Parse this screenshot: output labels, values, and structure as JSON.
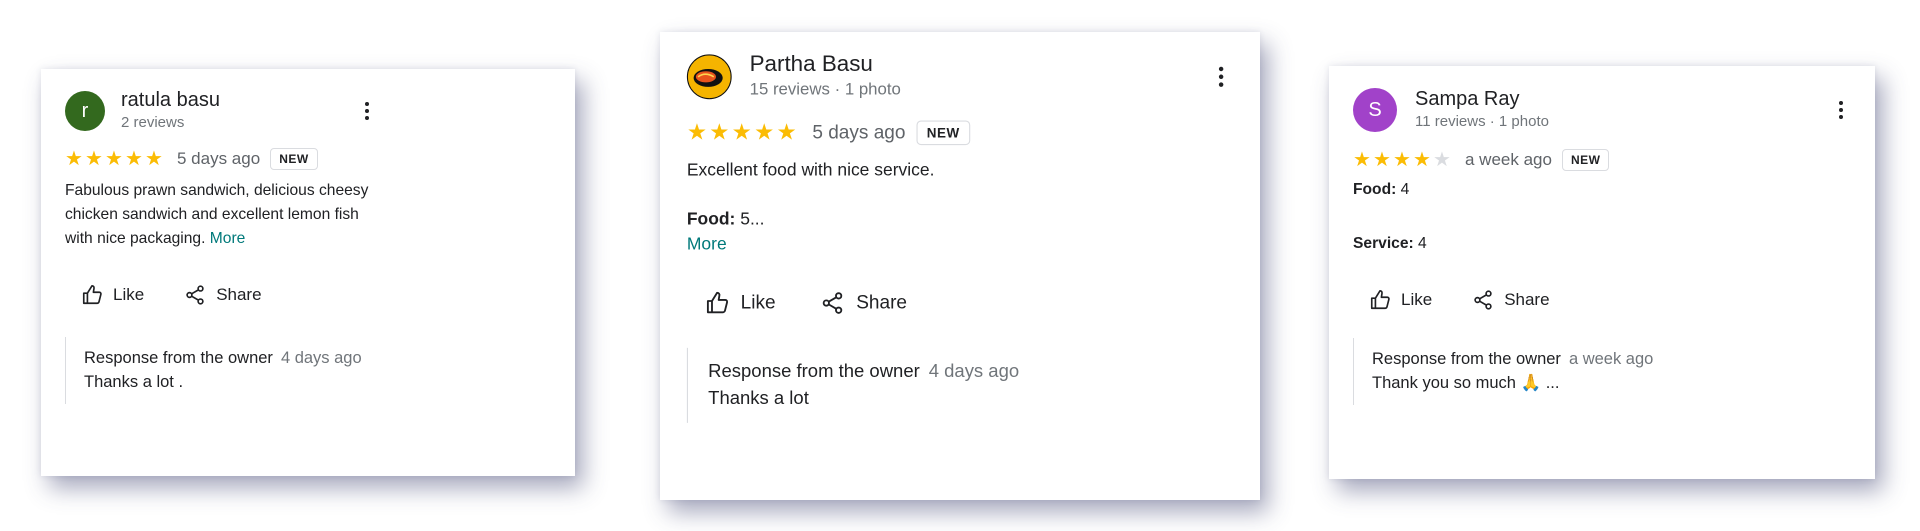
{
  "reviews": [
    {
      "reviewer_name": "ratula basu",
      "reviewer_meta": "2 reviews",
      "avatar_letter": "r",
      "avatar_color": "#33691e",
      "rating": 5,
      "time_ago": "5 days ago",
      "badge": "NEW",
      "text": "Fabulous prawn sandwich, delicious cheesy chicken sandwich and excellent lemon fish with nice packaging.",
      "more_label": "More",
      "like_label": "Like",
      "share_label": "Share",
      "owner_response_label": "Response from the owner",
      "owner_response_date": "4 days ago",
      "owner_response_text": "Thanks a lot ."
    },
    {
      "reviewer_name": "Partha Basu",
      "reviewer_meta": "15 reviews · 1 photo",
      "avatar_letter": "",
      "avatar_color": "#f5b400",
      "rating": 5,
      "time_ago": "5 days ago",
      "badge": "NEW",
      "text": "Excellent food with nice service.",
      "field_label": "Food:",
      "field_value": "5...",
      "more_label": "More",
      "like_label": "Like",
      "share_label": "Share",
      "owner_response_label": "Response from the owner",
      "owner_response_date": "4 days ago",
      "owner_response_text": "Thanks a lot"
    },
    {
      "reviewer_name": "Sampa Ray",
      "reviewer_meta": "11 reviews · 1 photo",
      "avatar_letter": "S",
      "avatar_color": "#a142c9",
      "rating": 4,
      "time_ago": "a week ago",
      "badge": "NEW",
      "food_label": "Food:",
      "food_value": "4",
      "service_label": "Service:",
      "service_value": "4",
      "like_label": "Like",
      "share_label": "Share",
      "owner_response_label": "Response from the owner",
      "owner_response_date": "a week ago",
      "owner_response_text": "Thank you so much 🙏 ..."
    }
  ],
  "colors": {
    "star_filled": "#fbbc04",
    "star_empty": "#dadce0",
    "more_link": "#00797a"
  }
}
